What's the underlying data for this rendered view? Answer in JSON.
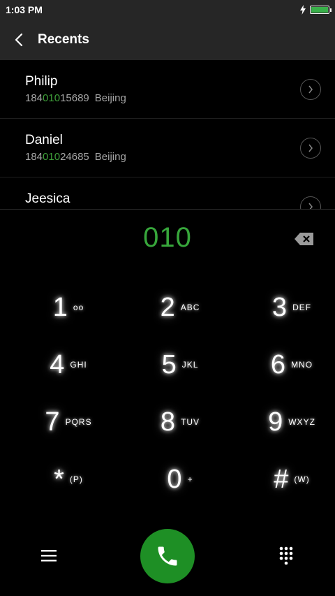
{
  "status_bar": {
    "time": "1:03 PM",
    "battery_level": 1.0
  },
  "header": {
    "title": "Recents"
  },
  "recents": [
    {
      "name": "Philip",
      "number_prefix": "184",
      "number_match": "010",
      "number_suffix": "15689",
      "location": "Beijing"
    },
    {
      "name": "Daniel",
      "number_prefix": "184",
      "number_match": "010",
      "number_suffix": "24685",
      "location": "Beijing"
    },
    {
      "name": "Jeesica",
      "number_prefix": "",
      "number_match": "",
      "number_suffix": "",
      "location": ""
    }
  ],
  "dialer": {
    "input": "010"
  },
  "keypad": [
    {
      "digit": "1",
      "letters": "oo"
    },
    {
      "digit": "2",
      "letters": "ABC"
    },
    {
      "digit": "3",
      "letters": "DEF"
    },
    {
      "digit": "4",
      "letters": "GHI"
    },
    {
      "digit": "5",
      "letters": "JKL"
    },
    {
      "digit": "6",
      "letters": "MNO"
    },
    {
      "digit": "7",
      "letters": "PQRS"
    },
    {
      "digit": "8",
      "letters": "TUV"
    },
    {
      "digit": "9",
      "letters": "WXYZ"
    },
    {
      "digit": "*",
      "letters": "(P)"
    },
    {
      "digit": "0",
      "letters": "+"
    },
    {
      "digit": "#",
      "letters": "(W)"
    }
  ],
  "colors": {
    "accent": "#37a63b",
    "call_button": "#1e8f25",
    "header_bg": "#262626"
  },
  "icons": {
    "back": "chevron-left-icon",
    "detail": "chevron-right-circle-icon",
    "backspace": "backspace-icon",
    "menu": "hamburger-menu-icon",
    "call": "phone-icon",
    "keypad_toggle": "dialpad-icon"
  }
}
